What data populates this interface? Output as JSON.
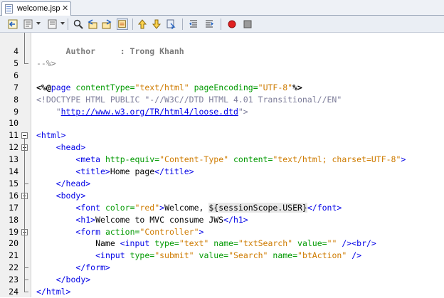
{
  "tab": {
    "label": "welcome.jsp",
    "close": "✕"
  },
  "toolbar": {
    "icons": [
      "back-icon",
      "history-icon",
      "find-icon",
      "find-previous-icon",
      "find-next-icon",
      "toggle-highlight-icon",
      "previous-bookmark-icon",
      "next-bookmark-icon",
      "toggle-bookmark-icon",
      "shift-left-icon",
      "shift-right-icon",
      "start-macro-icon",
      "stop-macro-icon"
    ]
  },
  "editor": {
    "lines": [
      {
        "n": "4",
        "segs": [
          {
            "c": "t-bold",
            "t": "      Author     : Trong Khanh"
          }
        ]
      },
      {
        "n": "5",
        "segs": [
          {
            "c": "t-cmt",
            "t": "--%>"
          }
        ]
      },
      {
        "n": "6",
        "segs": []
      },
      {
        "n": "7",
        "segs": [
          {
            "c": "t-dir",
            "t": "<%@"
          },
          {
            "c": "t-tag",
            "t": "page"
          },
          {
            "c": "t-txt",
            "t": " "
          },
          {
            "c": "t-attr",
            "t": "contentType="
          },
          {
            "c": "t-val",
            "t": "\"text/html\""
          },
          {
            "c": "t-txt",
            "t": " "
          },
          {
            "c": "t-attr",
            "t": "pageEncoding="
          },
          {
            "c": "t-val",
            "t": "\"UTF-8\""
          },
          {
            "c": "t-dir",
            "t": "%>"
          }
        ]
      },
      {
        "n": "8",
        "segs": [
          {
            "c": "t-dt",
            "t": "<!DOCTYPE HTML PUBLIC \"-//W3C//DTD HTML 4.01 Transitional//EN\""
          }
        ]
      },
      {
        "n": "9",
        "segs": [
          {
            "c": "t-dt",
            "t": "    \""
          },
          {
            "c": "t-link",
            "t": "http://www.w3.org/TR/html4/loose.dtd"
          },
          {
            "c": "t-dt",
            "t": "\">"
          }
        ]
      },
      {
        "n": "10",
        "segs": []
      },
      {
        "n": "11",
        "segs": [
          {
            "c": "t-tag",
            "t": "<html>"
          }
        ]
      },
      {
        "n": "12",
        "segs": [
          {
            "c": "t-txt",
            "t": "    "
          },
          {
            "c": "t-tag",
            "t": "<head>"
          }
        ]
      },
      {
        "n": "13",
        "segs": [
          {
            "c": "t-txt",
            "t": "        "
          },
          {
            "c": "t-tag",
            "t": "<meta"
          },
          {
            "c": "t-txt",
            "t": " "
          },
          {
            "c": "t-attr",
            "t": "http-equiv="
          },
          {
            "c": "t-val",
            "t": "\"Content-Type\""
          },
          {
            "c": "t-txt",
            "t": " "
          },
          {
            "c": "t-attr",
            "t": "content="
          },
          {
            "c": "t-val",
            "t": "\"text/html; charset=UTF-8\""
          },
          {
            "c": "t-tag",
            "t": ">"
          }
        ]
      },
      {
        "n": "14",
        "segs": [
          {
            "c": "t-txt",
            "t": "        "
          },
          {
            "c": "t-tag",
            "t": "<title>"
          },
          {
            "c": "t-txt",
            "t": "Home page"
          },
          {
            "c": "t-tag",
            "t": "</title>"
          }
        ]
      },
      {
        "n": "15",
        "segs": [
          {
            "c": "t-txt",
            "t": "    "
          },
          {
            "c": "t-tag",
            "t": "</head>"
          }
        ]
      },
      {
        "n": "16",
        "segs": [
          {
            "c": "t-txt",
            "t": "    "
          },
          {
            "c": "t-tag",
            "t": "<body>"
          }
        ]
      },
      {
        "n": "17",
        "segs": [
          {
            "c": "t-txt",
            "t": "        "
          },
          {
            "c": "t-tag",
            "t": "<font"
          },
          {
            "c": "t-txt",
            "t": " "
          },
          {
            "c": "t-attr",
            "t": "color="
          },
          {
            "c": "t-val",
            "t": "\"red\""
          },
          {
            "c": "t-tag",
            "t": ">"
          },
          {
            "c": "t-txt",
            "t": "Welcome, "
          },
          {
            "c": "t-el",
            "t": "${sessionScope.USER}"
          },
          {
            "c": "t-tag",
            "t": "</font>"
          }
        ]
      },
      {
        "n": "18",
        "segs": [
          {
            "c": "t-txt",
            "t": "        "
          },
          {
            "c": "t-tag",
            "t": "<h1>"
          },
          {
            "c": "t-txt",
            "t": "Welcome to MVC consume JWS"
          },
          {
            "c": "t-tag",
            "t": "</h1>"
          }
        ]
      },
      {
        "n": "19",
        "segs": [
          {
            "c": "t-txt",
            "t": "        "
          },
          {
            "c": "t-tag",
            "t": "<form"
          },
          {
            "c": "t-txt",
            "t": " "
          },
          {
            "c": "t-attr",
            "t": "action="
          },
          {
            "c": "t-val",
            "t": "\"Controller\""
          },
          {
            "c": "t-tag",
            "t": ">"
          }
        ]
      },
      {
        "n": "20",
        "segs": [
          {
            "c": "t-txt",
            "t": "            Name "
          },
          {
            "c": "t-tag",
            "t": "<input"
          },
          {
            "c": "t-txt",
            "t": " "
          },
          {
            "c": "t-attr",
            "t": "type="
          },
          {
            "c": "t-val",
            "t": "\"text\""
          },
          {
            "c": "t-txt",
            "t": " "
          },
          {
            "c": "t-attr",
            "t": "name="
          },
          {
            "c": "t-val",
            "t": "\"txtSearch\""
          },
          {
            "c": "t-txt",
            "t": " "
          },
          {
            "c": "t-attr",
            "t": "value="
          },
          {
            "c": "t-val",
            "t": "\"\""
          },
          {
            "c": "t-txt",
            "t": " "
          },
          {
            "c": "t-tag",
            "t": "/><br/>"
          }
        ]
      },
      {
        "n": "21",
        "segs": [
          {
            "c": "t-txt",
            "t": "            "
          },
          {
            "c": "t-tag",
            "t": "<input"
          },
          {
            "c": "t-txt",
            "t": " "
          },
          {
            "c": "t-attr",
            "t": "type="
          },
          {
            "c": "t-val",
            "t": "\"submit\""
          },
          {
            "c": "t-txt",
            "t": " "
          },
          {
            "c": "t-attr",
            "t": "value="
          },
          {
            "c": "t-val",
            "t": "\"Search\""
          },
          {
            "c": "t-txt",
            "t": " "
          },
          {
            "c": "t-attr",
            "t": "name="
          },
          {
            "c": "t-val",
            "t": "\"btAction\""
          },
          {
            "c": "t-txt",
            "t": " "
          },
          {
            "c": "t-tag",
            "t": "/>"
          }
        ]
      },
      {
        "n": "22",
        "segs": [
          {
            "c": "t-txt",
            "t": "        "
          },
          {
            "c": "t-tag",
            "t": "</form>"
          }
        ]
      },
      {
        "n": "23",
        "segs": [
          {
            "c": "t-txt",
            "t": "    "
          },
          {
            "c": "t-tag",
            "t": "</body>"
          }
        ]
      },
      {
        "n": "24",
        "segs": [
          {
            "c": "t-tag",
            "t": "</html>"
          }
        ]
      }
    ]
  },
  "colors": {
    "tag": "#0000e6",
    "attr": "#009900",
    "value": "#ce7b00",
    "comment": "#808080"
  }
}
